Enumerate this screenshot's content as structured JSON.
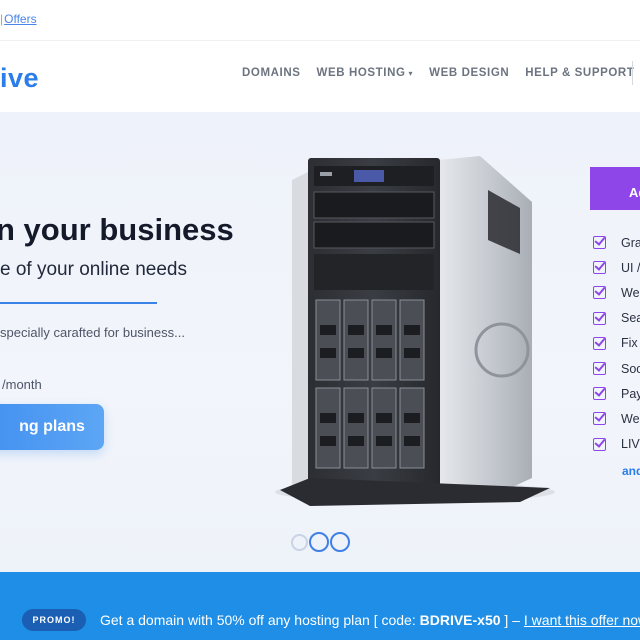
{
  "topbar": {
    "offers_label": "Offers"
  },
  "header": {
    "logo_text": "ive",
    "nav": [
      {
        "label": "DOMAINS"
      },
      {
        "label": "WEB HOSTING",
        "has_dropdown": true
      },
      {
        "label": "WEB DESIGN"
      },
      {
        "label": "HELP & SUPPORT"
      }
    ]
  },
  "hero": {
    "title": "n your business",
    "subtitle": "e of your online needs",
    "description": "specially carafted for business...",
    "price_suffix": "/month",
    "cta_label": "ng plans"
  },
  "panel": {
    "header": "Ad",
    "features": [
      "Gra",
      "UI /",
      "We",
      "Sea",
      "Fix",
      "Soc",
      "Pay",
      "We",
      "LIV"
    ],
    "more_link": "and"
  },
  "slider": {
    "dots": 3,
    "active_index": 1
  },
  "promo": {
    "badge": "PROMO!",
    "text_before": "Get a domain with 50% off any hosting plan [ code: ",
    "code": "BDRIVE-x50",
    "text_after": " ] – ",
    "link": "I want this offer now"
  },
  "colors": {
    "accent_blue": "#2b7de9",
    "accent_purple": "#8e46e8",
    "promo_bar": "#1e8ee6"
  },
  "icons": {
    "checkbox": "checkbox-checked-icon",
    "caret": "chevron-down-icon"
  }
}
